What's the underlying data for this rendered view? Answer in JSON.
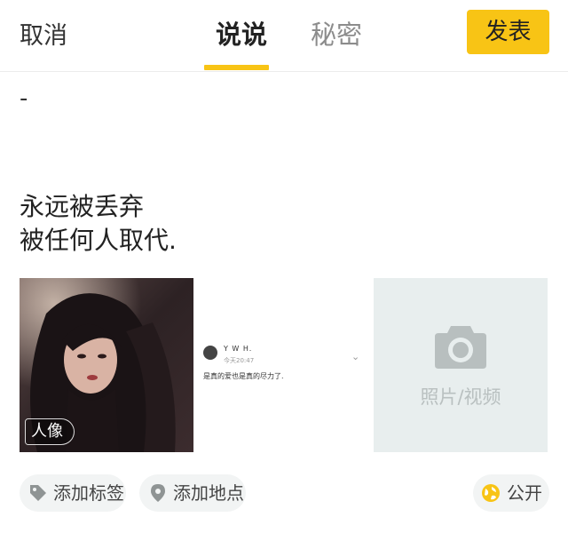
{
  "header": {
    "cancel_label": "取消",
    "tabs": [
      {
        "label": "说说",
        "active": true
      },
      {
        "label": "秘密",
        "active": false
      }
    ],
    "publish_label": "发表"
  },
  "composer": {
    "first_line": "-",
    "text_lines": [
      "永远被丢弃",
      "被任何人取代."
    ]
  },
  "attachments": [
    {
      "type": "photo",
      "badge": "人像"
    },
    {
      "type": "screenshot",
      "name": "Y W H.",
      "time": "今天20:47",
      "text": "是真的爱也是真的尽力了."
    }
  ],
  "add_media_label": "照片/视频",
  "actions": {
    "tag_label": "添加标签",
    "location_label": "添加地点",
    "privacy_label": "公开"
  },
  "colors": {
    "accent": "#f8c415",
    "media_tile": "#e8eeee",
    "pill_bg": "#f2f4f4"
  }
}
